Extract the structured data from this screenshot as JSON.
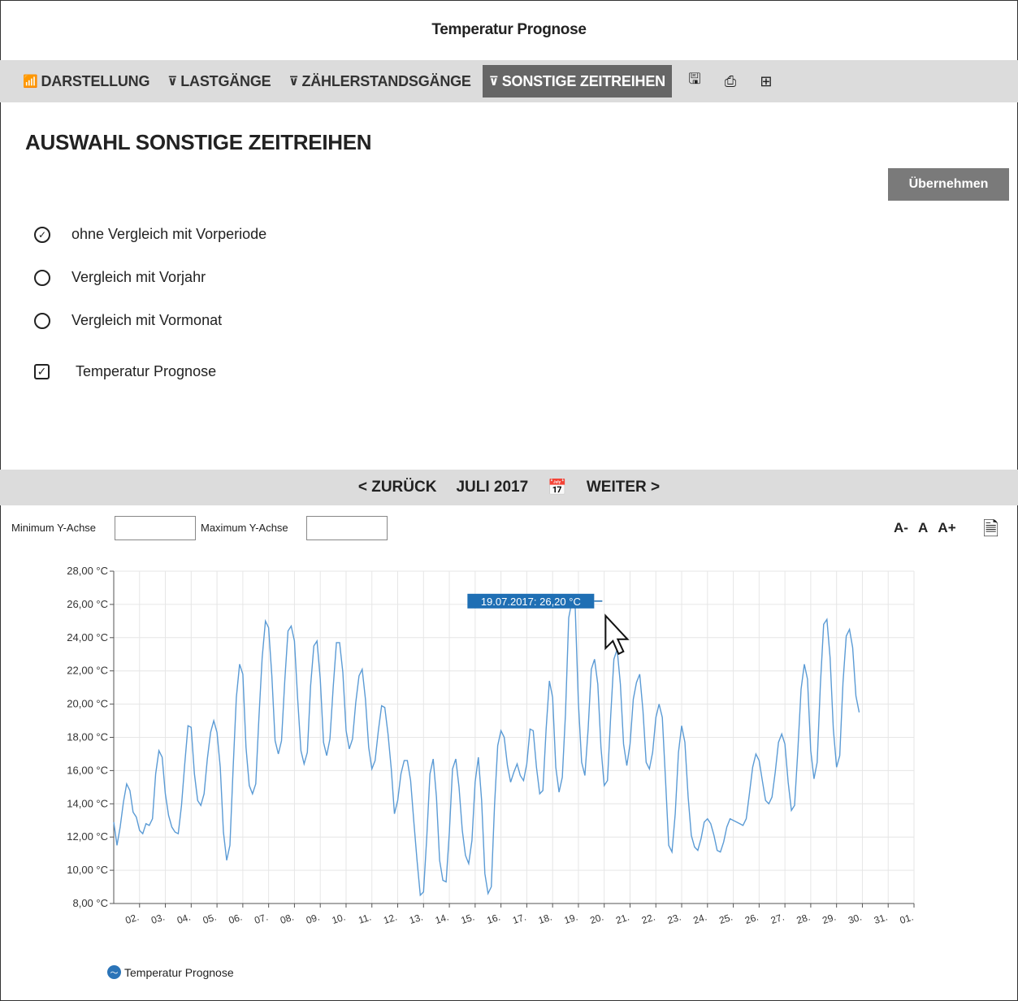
{
  "window": {
    "title": "Temperatur Prognose"
  },
  "toolbar": {
    "tabs": [
      {
        "label": "DARSTELLUNG",
        "icon": "chart-icon"
      },
      {
        "label": "LASTGÄNGE",
        "icon": "meter-icon"
      },
      {
        "label": "ZÄHLERSTANDSGÄNGE",
        "icon": "meter-icon"
      },
      {
        "label": "SONSTIGE ZEITREIHEN",
        "icon": "meter-icon",
        "active": true
      }
    ],
    "tools": [
      "save-icon",
      "print-icon",
      "table-icon"
    ]
  },
  "main": {
    "title": "AUSWAHL SONSTIGE ZEITREIHEN",
    "apply_label": "Übernehmen",
    "options": [
      {
        "label": "ohne Vergleich mit Vorperiode",
        "checked": true
      },
      {
        "label": "Vergleich mit Vorjahr",
        "checked": false
      },
      {
        "label": "Vergleich mit Vormonat",
        "checked": false
      }
    ],
    "checkbox": {
      "label": "Temperatur Prognose",
      "checked": true
    }
  },
  "nav": {
    "back": "< ZURÜCK",
    "period": "JULI 2017",
    "next": "WEITER >"
  },
  "controls": {
    "ymin_label": "Minimum Y-Achse",
    "ymax_label": "Maximum Y-Achse",
    "ymin_value": "",
    "ymax_value": "",
    "font_smaller": "A-",
    "font_normal": "A",
    "font_larger": "A+"
  },
  "chart_data": {
    "type": "line",
    "series": [
      {
        "name": "Temperatur Prognose",
        "color": "#5b9bd5",
        "x_start": 1,
        "x_step": 0.125,
        "values": [
          12.9,
          11.5,
          12.6,
          14.1,
          15.2,
          14.8,
          13.5,
          13.2,
          12.4,
          12.2,
          12.8,
          12.7,
          13.1,
          15.8,
          17.2,
          16.8,
          14.6,
          13.3,
          12.6,
          12.3,
          12.2,
          13.9,
          16.4,
          18.7,
          18.6,
          15.8,
          14.2,
          13.9,
          14.6,
          16.7,
          18.3,
          19.0,
          18.3,
          16.2,
          12.3,
          10.6,
          11.5,
          16.2,
          20.4,
          22.4,
          21.8,
          17.4,
          15.1,
          14.6,
          15.2,
          19.2,
          22.8,
          25.0,
          24.6,
          21.7,
          17.8,
          17.0,
          17.8,
          21.4,
          24.4,
          24.7,
          23.8,
          20.3,
          17.2,
          16.4,
          17.1,
          21.1,
          23.5,
          23.8,
          21.5,
          17.7,
          16.9,
          17.9,
          21.0,
          23.7,
          23.7,
          21.9,
          18.4,
          17.3,
          17.9,
          20.1,
          21.7,
          22.1,
          20.3,
          17.4,
          16.1,
          16.6,
          18.4,
          19.9,
          19.8,
          18.2,
          16.1,
          13.4,
          14.2,
          15.8,
          16.6,
          16.6,
          15.4,
          12.9,
          10.6,
          8.5,
          8.7,
          12.0,
          15.8,
          16.7,
          14.4,
          10.6,
          9.4,
          9.3,
          12.3,
          16.1,
          16.7,
          15.0,
          12.4,
          10.9,
          10.4,
          11.8,
          15.3,
          16.8,
          14.2,
          9.8,
          8.6,
          9.0,
          13.9,
          17.5,
          18.4,
          18.0,
          16.3,
          15.3,
          15.9,
          16.4,
          15.7,
          15.4,
          16.4,
          18.5,
          18.4,
          16.2,
          14.6,
          14.8,
          18.5,
          21.4,
          20.4,
          16.2,
          14.7,
          15.6,
          19.4,
          25.2,
          26.2,
          25.8,
          20.1,
          16.5,
          15.7,
          18.5,
          22.1,
          22.7,
          21.2,
          17.4,
          15.1,
          15.4,
          19.3,
          22.7,
          23.3,
          21.2,
          17.6,
          16.3,
          17.6,
          20.3,
          21.3,
          21.8,
          19.6,
          16.5,
          16.1,
          17.1,
          19.2,
          20.0,
          19.2,
          15.4,
          11.5,
          11.1,
          13.4,
          17.1,
          18.7,
          17.7,
          14.4,
          12.1,
          11.4,
          11.2,
          11.9,
          12.9,
          13.1,
          12.8,
          12.1,
          11.2,
          11.1,
          11.7,
          12.6,
          13.1,
          13.0,
          12.9,
          12.8,
          12.7,
          13.1,
          14.6,
          16.2,
          17.0,
          16.6,
          15.4,
          14.2,
          14.0,
          14.4,
          15.9,
          17.7,
          18.2,
          17.6,
          15.3,
          13.6,
          13.9,
          17.2,
          20.9,
          22.4,
          21.5,
          17.2,
          15.5,
          16.5,
          21.2,
          24.8,
          25.1,
          22.8,
          18.5,
          16.2,
          16.9,
          21.3,
          24.1,
          24.5,
          23.4,
          20.5,
          19.5
        ]
      }
    ],
    "xlim": [
      1,
      32
    ],
    "ylim": [
      8,
      28
    ],
    "yticks": [
      8,
      10,
      12,
      14,
      16,
      18,
      20,
      22,
      24,
      26,
      28
    ],
    "ytick_labels": [
      "8,00 °C",
      "10,00 °C",
      "12,00 °C",
      "14,00 °C",
      "16,00 °C",
      "18,00 °C",
      "20,00 °C",
      "22,00 °C",
      "24,00 °C",
      "26,00 °C",
      "28,00 °C"
    ],
    "xtick_labels": [
      "02.",
      "03.",
      "04.",
      "05.",
      "06.",
      "07.",
      "08.",
      "09.",
      "10.",
      "11.",
      "12.",
      "13.",
      "14.",
      "15.",
      "16.",
      "17.",
      "18.",
      "19.",
      "20.",
      "21.",
      "22.",
      "23.",
      "24.",
      "25.",
      "26.",
      "27.",
      "28.",
      "29.",
      "30.",
      "31.",
      "01."
    ],
    "grid": true,
    "tooltip": {
      "text": "19.07.2017: 26,20 °C",
      "x": 19.8,
      "y": 26.2
    },
    "legend": {
      "label": "Temperatur Prognose",
      "placement": "bottom-left"
    }
  }
}
